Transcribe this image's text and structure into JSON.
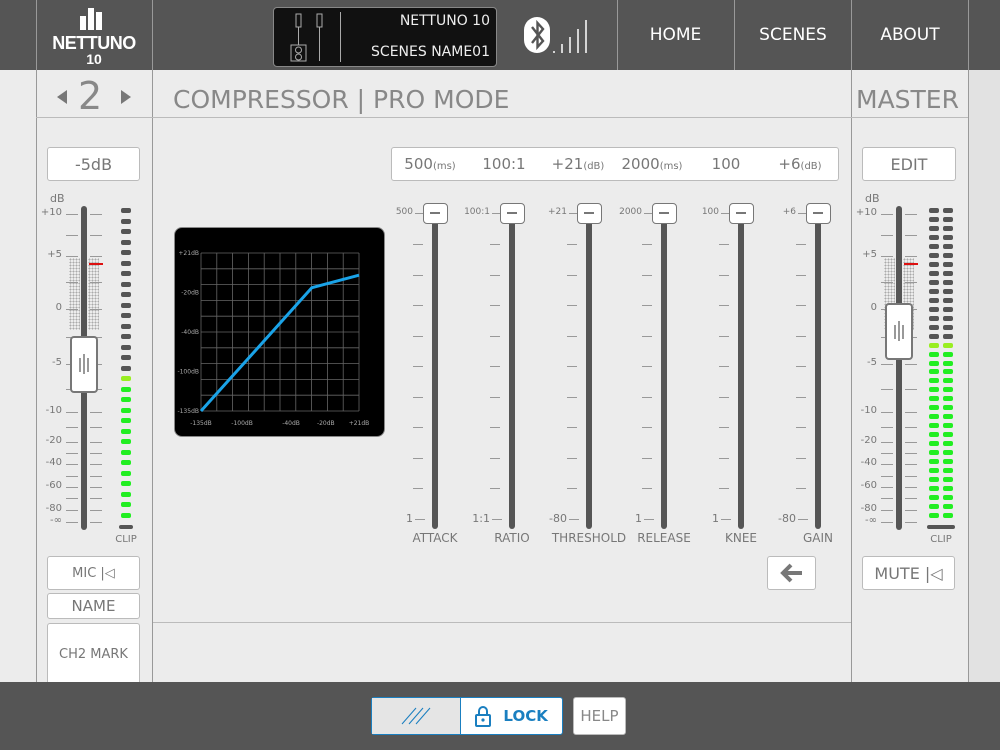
{
  "header": {
    "logo_text": "NETTUNO",
    "logo_sub": "10",
    "display": {
      "device": "NETTUNO 10",
      "scene": "SCENES NAME01"
    },
    "bluetooth_icon": "bluetooth-icon",
    "signal_icon": "signal-bars-icon",
    "nav": [
      {
        "label": "HOME"
      },
      {
        "label": "SCENES"
      },
      {
        "label": "ABOUT"
      }
    ]
  },
  "channel": {
    "number": "2",
    "prev_icon": "triangle-left-icon",
    "next_icon": "triangle-right-icon",
    "gain_label": "-5dB",
    "db_label": "dB",
    "clip_label": "CLIP",
    "scale": [
      "+10",
      "+5",
      "0",
      "-5",
      "-10",
      "-20",
      "-40",
      "-60",
      "-80",
      "-∞"
    ],
    "fader_db": -5,
    "meter_lit_leds": 14,
    "meter_total_leds": 30,
    "mic_label": "MIC |◁",
    "name_label": "NAME",
    "mark_label": "CH2 MARK"
  },
  "page_title": "COMPRESSOR | PRO MODE",
  "master": {
    "title": "MASTER",
    "edit_label": "EDIT",
    "db_label": "dB",
    "clip_label": "CLIP",
    "scale": [
      "+10",
      "+5",
      "0",
      "-5",
      "-10",
      "-20",
      "-40",
      "-60",
      "-80",
      "-∞"
    ],
    "fader_db": -2,
    "meter_lit_leds": 20,
    "meter_total_leds": 35,
    "mute_label": "MUTE |◁"
  },
  "compressor": {
    "values": [
      {
        "value": "500",
        "unit": "(ms)"
      },
      {
        "value": "100:1",
        "unit": ""
      },
      {
        "value": "+21",
        "unit": "(dB)"
      },
      {
        "value": "2000",
        "unit": "(ms)"
      },
      {
        "value": "100",
        "unit": ""
      },
      {
        "value": "+6",
        "unit": "(dB)"
      }
    ],
    "sliders": [
      {
        "name": "ATTACK",
        "max": "500",
        "min": "1",
        "level": 1
      },
      {
        "name": "RATIO",
        "max": "100:1",
        "min": "1:1",
        "level": 1
      },
      {
        "name": "THRESHOLD",
        "max": "+21",
        "min": "-80",
        "level": 1
      },
      {
        "name": "RELEASE",
        "max": "2000",
        "min": "1",
        "level": 1
      },
      {
        "name": "KNEE",
        "max": "100",
        "min": "1",
        "level": 1
      },
      {
        "name": "GAIN",
        "max": "+6",
        "min": "-80",
        "level": 1
      }
    ],
    "back_icon": "arrow-left-icon"
  },
  "chart_data": {
    "type": "line",
    "x_ticks": [
      "-135dB",
      "-100dB",
      "-40dB",
      "-20dB",
      "+21dB"
    ],
    "y_ticks": [
      "+21dB",
      "-20dB",
      "-40dB",
      "-100dB",
      "-135dB"
    ],
    "x": [
      -135,
      -28,
      21
    ],
    "y": [
      -135,
      -15,
      -2
    ],
    "grid": true,
    "line_color": "#1aa3e8",
    "background": "#000000"
  },
  "footer": {
    "lock_label": "LOCK",
    "help_label": "HELP",
    "lock_icon": "lock-icon",
    "slash_icon": "slashes-icon"
  },
  "colors": {
    "accent": "#1a7fc0",
    "meter_green": "#22ee22",
    "peak_red": "#dd1111"
  }
}
